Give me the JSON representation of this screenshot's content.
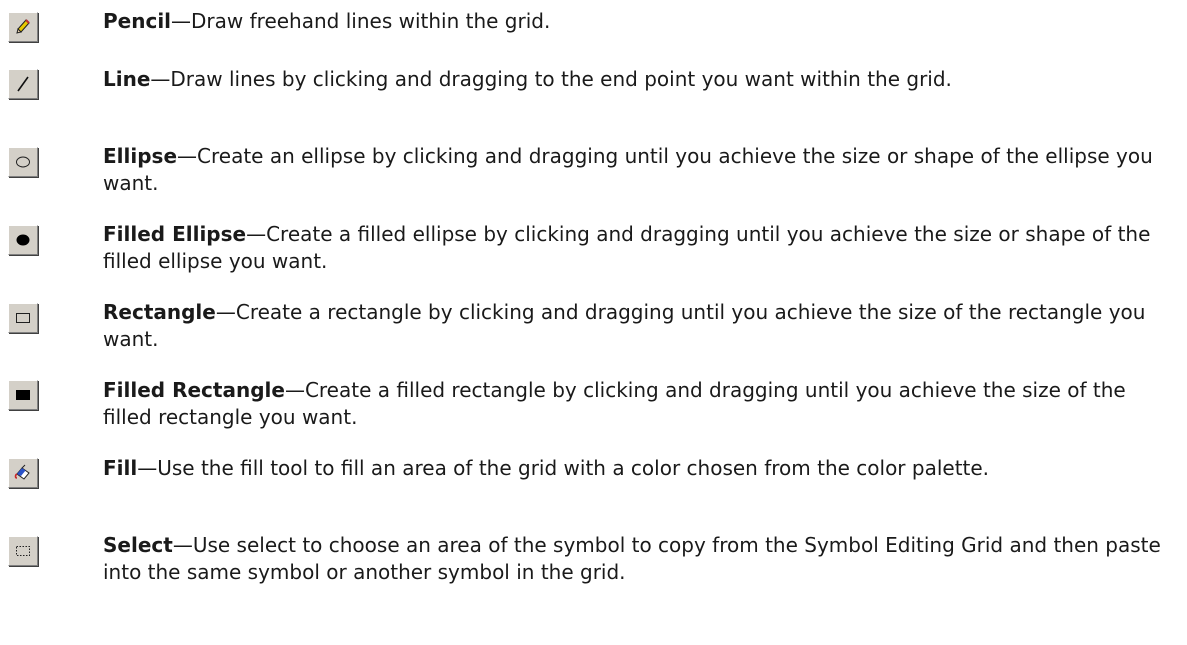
{
  "tools": [
    {
      "name": "Pencil",
      "icon": "pencil-icon",
      "description": "—Draw freehand lines within the grid."
    },
    {
      "name": "Line",
      "icon": "line-icon",
      "description": "—Draw lines by clicking and dragging to the end point you want within the grid."
    },
    {
      "name": "Ellipse",
      "icon": "ellipse-icon",
      "description": "—Create an ellipse by clicking and dragging until you achieve the size or shape of the ellipse you want."
    },
    {
      "name": "Filled Ellipse",
      "icon": "filled-ellipse-icon",
      "description": "—Create a filled ellipse by clicking and dragging until you achieve the size or shape of the filled ellipse you want."
    },
    {
      "name": "Rectangle",
      "icon": "rectangle-icon",
      "description": "—Create a rectangle by clicking and dragging until you achieve the size of the rectangle you want."
    },
    {
      "name": "Filled Rectangle",
      "icon": "filled-rectangle-icon",
      "description": "—Create a filled rectangle by clicking and dragging until you achieve the size of the filled rectangle you want."
    },
    {
      "name": "Fill",
      "icon": "fill-bucket-icon",
      "description": "—Use the fill tool to fill an area of the grid with a color chosen from the color palette."
    },
    {
      "name": "Select",
      "icon": "select-marquee-icon",
      "description": "—Use select to choose an area of the symbol to copy from the Symbol Editing Grid and then paste into the same symbol or another symbol in the grid."
    }
  ]
}
